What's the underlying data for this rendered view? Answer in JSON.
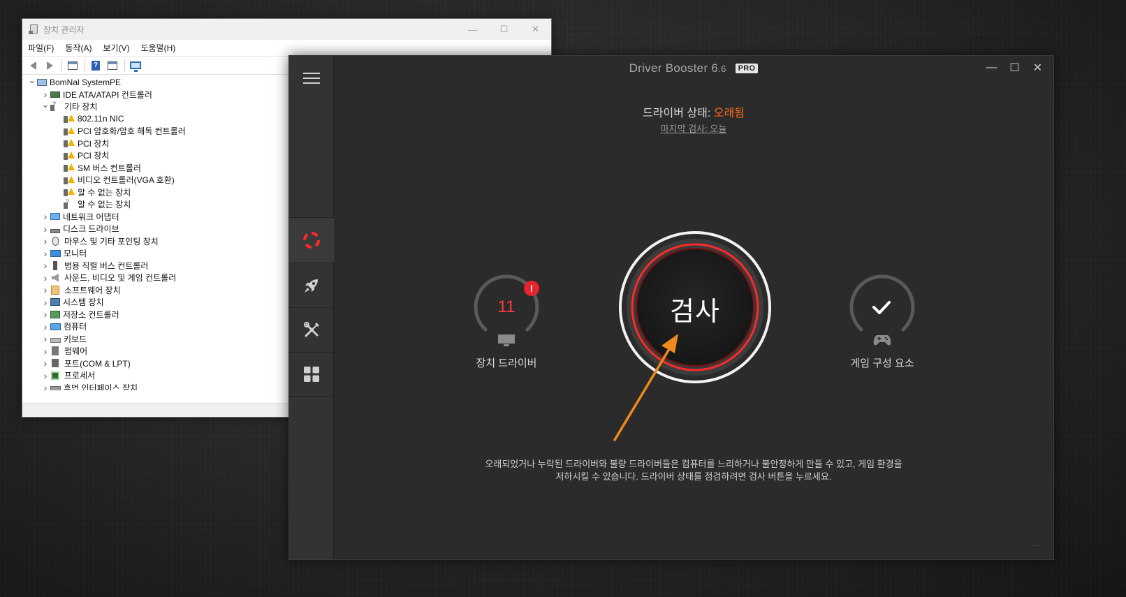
{
  "device_manager": {
    "title": "장치 관리자",
    "menus": [
      "파일(F)",
      "동작(A)",
      "보기(V)",
      "도움말(H)"
    ],
    "toolbar_icons": [
      "back-icon",
      "forward-icon",
      "properties-sheet-icon",
      "help-icon",
      "properties-icon",
      "monitor-icon"
    ],
    "tree": [
      {
        "label": "BomNal SystemPE",
        "level": 0,
        "toggle": "expanded",
        "icon": "computer"
      },
      {
        "label": "IDE ATA/ATAPI 컨트롤러",
        "level": 1,
        "toggle": "collapsed",
        "icon": "chip"
      },
      {
        "label": "기타 장치",
        "level": 1,
        "toggle": "expanded",
        "icon": "other"
      },
      {
        "label": "802.11n NIC",
        "level": 2,
        "toggle": "none",
        "icon": "warn"
      },
      {
        "label": "PCI 암호화/암호 해독 컨트롤러",
        "level": 2,
        "toggle": "none",
        "icon": "warn"
      },
      {
        "label": "PCI 장치",
        "level": 2,
        "toggle": "none",
        "icon": "warn"
      },
      {
        "label": "PCI 장치",
        "level": 2,
        "toggle": "none",
        "icon": "warn"
      },
      {
        "label": "SM 버스 컨트롤러",
        "level": 2,
        "toggle": "none",
        "icon": "warn"
      },
      {
        "label": "비디오 컨트롤러(VGA 호환)",
        "level": 2,
        "toggle": "none",
        "icon": "warn"
      },
      {
        "label": "알 수 없는 장치",
        "level": 2,
        "toggle": "none",
        "icon": "warn"
      },
      {
        "label": "알 수 없는 장치",
        "level": 2,
        "toggle": "none",
        "icon": "other"
      },
      {
        "label": "네트워크 어댑터",
        "level": 1,
        "toggle": "collapsed",
        "icon": "net"
      },
      {
        "label": "디스크 드라이브",
        "level": 1,
        "toggle": "collapsed",
        "icon": "disk"
      },
      {
        "label": "마우스 및 기타 포인팅 장치",
        "level": 1,
        "toggle": "collapsed",
        "icon": "mouse"
      },
      {
        "label": "모니터",
        "level": 1,
        "toggle": "collapsed",
        "icon": "monitor"
      },
      {
        "label": "범용 직렬 버스 컨트롤러",
        "level": 1,
        "toggle": "collapsed",
        "icon": "usb"
      },
      {
        "label": "사운드, 비디오 및 게임 컨트롤러",
        "level": 1,
        "toggle": "collapsed",
        "icon": "sound"
      },
      {
        "label": "소프트웨어 장치",
        "level": 1,
        "toggle": "collapsed",
        "icon": "soft"
      },
      {
        "label": "시스템 장치",
        "level": 1,
        "toggle": "collapsed",
        "icon": "sys"
      },
      {
        "label": "저장소 컨트롤러",
        "level": 1,
        "toggle": "collapsed",
        "icon": "storage"
      },
      {
        "label": "컴퓨터",
        "level": 1,
        "toggle": "collapsed",
        "icon": "cpu-monitor"
      },
      {
        "label": "키보드",
        "level": 1,
        "toggle": "collapsed",
        "icon": "kbd"
      },
      {
        "label": "펌웨어",
        "level": 1,
        "toggle": "collapsed",
        "icon": "fw"
      },
      {
        "label": "포트(COM & LPT)",
        "level": 1,
        "toggle": "collapsed",
        "icon": "port"
      },
      {
        "label": "프로세서",
        "level": 1,
        "toggle": "collapsed",
        "icon": "proc"
      },
      {
        "label": "휴먼 인터페이스 장치",
        "level": 1,
        "toggle": "collapsed",
        "icon": "hid"
      }
    ]
  },
  "driver_booster": {
    "title_main": "Driver Booster 6",
    "title_version": ".6",
    "pro_badge": "PRO",
    "status_label": "드라이버 상태:",
    "status_value": "오래됨",
    "last_scan": "마지막 검사: 오늘",
    "outdated_count": "11",
    "alert_mark": "!",
    "driver_label": "장치 드라이버",
    "game_label": "게임 구성 요소",
    "scan_button": "검사",
    "hint_line1": "오래되었거나 누락된 드라이버와 불량 드라이버들은 컴퓨터를 느리하거나 불안정하게 만들 수 있고, 게임 환경을",
    "hint_line2": "저하시킬 수 있습니다. 드라이버 상태를 점검하려면 검사 버튼을 누르세요.",
    "colors": {
      "status_outdated": "#ff6a1a",
      "count_red": "#ff3b3b",
      "scan_ring_red": "#ff2a2a",
      "annotation_arrow": "#f08a1c"
    },
    "sidebar_icons": [
      "menu-icon",
      "scan-icon",
      "rocket-icon",
      "tools-icon",
      "action-center-icon"
    ]
  }
}
